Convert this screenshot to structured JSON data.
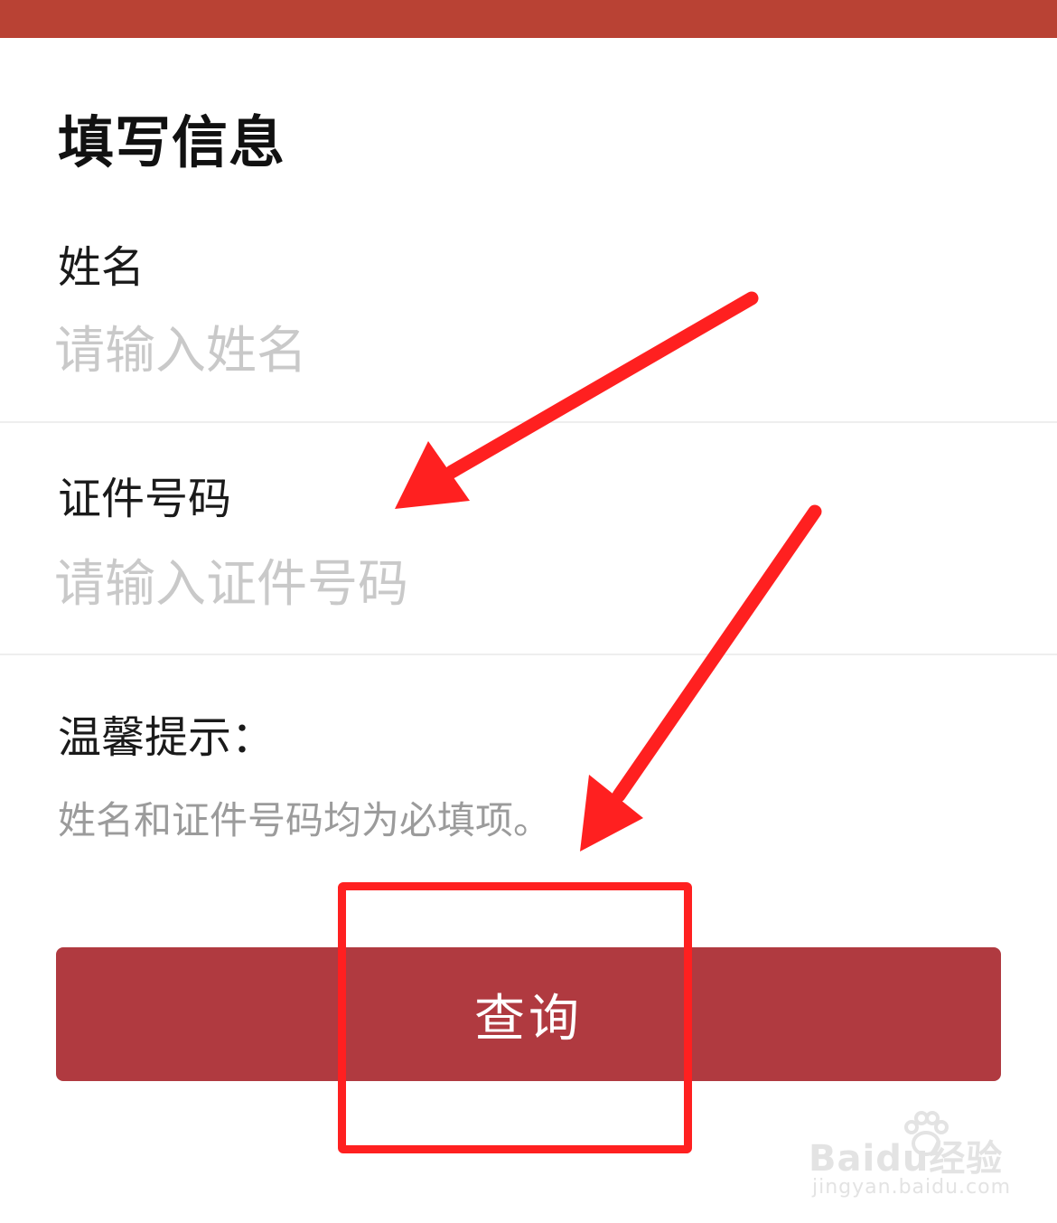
{
  "header": {
    "title": "填写信息"
  },
  "form": {
    "name": {
      "label": "姓名",
      "placeholder": "请输入姓名",
      "value": ""
    },
    "id_number": {
      "label": "证件号码",
      "placeholder": "请输入证件号码",
      "value": ""
    }
  },
  "tip": {
    "title": "温馨提示：",
    "text": "姓名和证件号码均为必填项。"
  },
  "actions": {
    "query_label": "查询"
  },
  "watermark": {
    "brand": "Baidu经验",
    "url": "jingyan.baidu.com"
  },
  "colors": {
    "top_bar": "#b94234",
    "button": "#b03a40",
    "annotation": "#ff2020",
    "placeholder": "#c9c9c9"
  }
}
